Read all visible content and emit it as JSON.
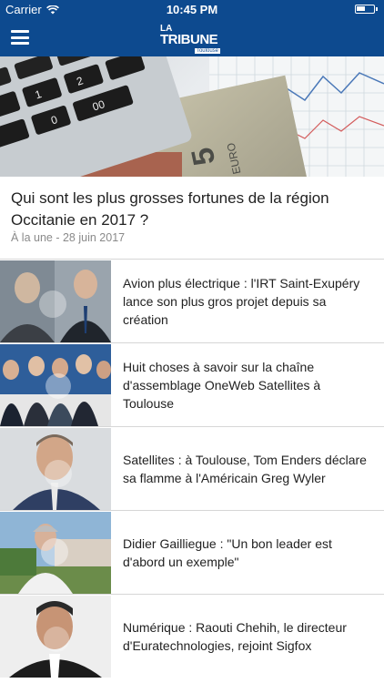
{
  "status_bar": {
    "carrier": "Carrier",
    "time": "10:45 PM"
  },
  "nav": {
    "logo_top": "LA",
    "logo_main": "TRIBUNE",
    "logo_city": "Toulouse"
  },
  "featured": {
    "title": "Qui sont les plus grosses fortunes de la région Occitanie en 2017 ?",
    "meta": "À la une - 28 juin 2017"
  },
  "articles": [
    {
      "title": "Avion plus électrique : l'IRT Saint-Exupéry lance son plus gros projet depuis sa création"
    },
    {
      "title": "Huit choses à savoir sur la chaîne d'assemblage OneWeb Satellites à Toulouse"
    },
    {
      "title": "Satellites : à Toulouse, Tom Enders déclare sa flamme à l'Américain Greg Wyler"
    },
    {
      "title": "Didier Gailliegue : \"Un bon leader est d'abord un exemple\""
    },
    {
      "title": "Numérique : Raouti Chehih, le directeur d'Euratechnologies, rejoint Sigfox"
    }
  ],
  "colors": {
    "brand": "#0d4a8f",
    "text": "#222222",
    "meta": "#8a8a8a"
  }
}
